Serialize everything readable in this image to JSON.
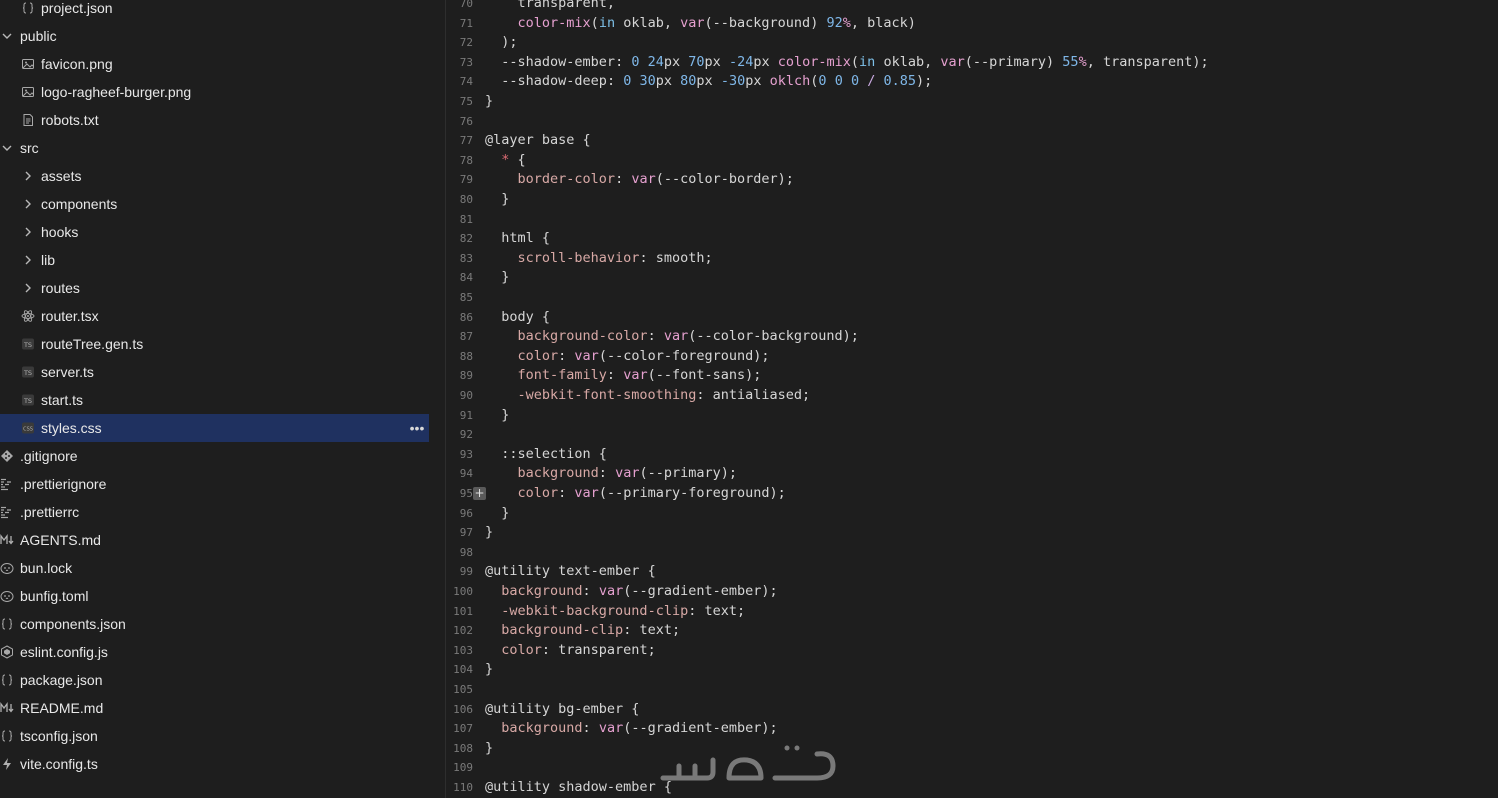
{
  "sidebar": {
    "items": [
      {
        "label": "project.json",
        "icon": "braces-icon",
        "depth": 1
      },
      {
        "label": "public",
        "icon": "chevron-down-icon",
        "depth": 0,
        "folder": true
      },
      {
        "label": "favicon.png",
        "icon": "image-icon",
        "depth": 1
      },
      {
        "label": "logo-ragheef-burger.png",
        "icon": "image-icon",
        "depth": 1
      },
      {
        "label": "robots.txt",
        "icon": "file-text-icon",
        "depth": 1
      },
      {
        "label": "src",
        "icon": "chevron-down-icon",
        "depth": 0,
        "folder": true
      },
      {
        "label": "assets",
        "icon": "chevron-right-icon",
        "depth": 1,
        "folder": true
      },
      {
        "label": "components",
        "icon": "chevron-right-icon",
        "depth": 1,
        "folder": true
      },
      {
        "label": "hooks",
        "icon": "chevron-right-icon",
        "depth": 1,
        "folder": true
      },
      {
        "label": "lib",
        "icon": "chevron-right-icon",
        "depth": 1,
        "folder": true
      },
      {
        "label": "routes",
        "icon": "chevron-right-icon",
        "depth": 1,
        "folder": true
      },
      {
        "label": "router.tsx",
        "icon": "react-icon",
        "depth": 1
      },
      {
        "label": "routeTree.gen.ts",
        "icon": "typescript-icon",
        "depth": 1
      },
      {
        "label": "server.ts",
        "icon": "typescript-icon",
        "depth": 1
      },
      {
        "label": "start.ts",
        "icon": "typescript-icon",
        "depth": 1
      },
      {
        "label": "styles.css",
        "icon": "css-icon",
        "depth": 1,
        "selected": true
      },
      {
        "label": ".gitignore",
        "icon": "git-icon",
        "depth": 0
      },
      {
        "label": ".prettierignore",
        "icon": "prettier-icon",
        "depth": 0
      },
      {
        "label": ".prettierrc",
        "icon": "prettier-icon",
        "depth": 0
      },
      {
        "label": "AGENTS.md",
        "icon": "markdown-icon",
        "depth": 0
      },
      {
        "label": "bun.lock",
        "icon": "bun-icon",
        "depth": 0
      },
      {
        "label": "bunfig.toml",
        "icon": "bun-icon",
        "depth": 0
      },
      {
        "label": "components.json",
        "icon": "braces-icon",
        "depth": 0
      },
      {
        "label": "eslint.config.js",
        "icon": "eslint-icon",
        "depth": 0
      },
      {
        "label": "package.json",
        "icon": "braces-icon",
        "depth": 0
      },
      {
        "label": "README.md",
        "icon": "markdown-icon",
        "depth": 0
      },
      {
        "label": "tsconfig.json",
        "icon": "braces-icon",
        "depth": 0
      },
      {
        "label": "vite.config.ts",
        "icon": "vite-icon",
        "depth": 0
      }
    ],
    "more_label": "•••"
  },
  "editor": {
    "fold_label": "+",
    "lines": [
      {
        "n": "70",
        "code": "    transparent,"
      },
      {
        "n": "71",
        "code": "    color-mix(in oklab, var(--background) 92%, black)"
      },
      {
        "n": "72",
        "code": "  );"
      },
      {
        "n": "73",
        "code": "  --shadow-ember: 0 24px 70px -24px color-mix(in oklab, var(--primary) 55%, transparent);"
      },
      {
        "n": "74",
        "code": "  --shadow-deep: 0 30px 80px -30px oklch(0 0 0 / 0.85);"
      },
      {
        "n": "75",
        "code": "}"
      },
      {
        "n": "76",
        "code": ""
      },
      {
        "n": "77",
        "code": "@layer base {"
      },
      {
        "n": "78",
        "code": "  * {"
      },
      {
        "n": "79",
        "code": "    border-color: var(--color-border);"
      },
      {
        "n": "80",
        "code": "  }"
      },
      {
        "n": "81",
        "code": ""
      },
      {
        "n": "82",
        "code": "  html {"
      },
      {
        "n": "83",
        "code": "    scroll-behavior: smooth;"
      },
      {
        "n": "84",
        "code": "  }"
      },
      {
        "n": "85",
        "code": ""
      },
      {
        "n": "86",
        "code": "  body {"
      },
      {
        "n": "87",
        "code": "    background-color: var(--color-background);"
      },
      {
        "n": "88",
        "code": "    color: var(--color-foreground);"
      },
      {
        "n": "89",
        "code": "    font-family: var(--font-sans);"
      },
      {
        "n": "90",
        "code": "    -webkit-font-smoothing: antialiased;"
      },
      {
        "n": "91",
        "code": "  }"
      },
      {
        "n": "92",
        "code": ""
      },
      {
        "n": "93",
        "code": "  ::selection {"
      },
      {
        "n": "94",
        "code": "    background: var(--primary);"
      },
      {
        "n": "95",
        "code": "    color: var(--primary-foreground);"
      },
      {
        "n": "96",
        "code": "  }"
      },
      {
        "n": "97",
        "code": "}"
      },
      {
        "n": "98",
        "code": ""
      },
      {
        "n": "99",
        "code": "@utility text-ember {"
      },
      {
        "n": "100",
        "code": "  background: var(--gradient-ember);"
      },
      {
        "n": "101",
        "code": "  -webkit-background-clip: text;"
      },
      {
        "n": "102",
        "code": "  background-clip: text;"
      },
      {
        "n": "103",
        "code": "  color: transparent;"
      },
      {
        "n": "104",
        "code": "}"
      },
      {
        "n": "105",
        "code": ""
      },
      {
        "n": "106",
        "code": "@utility bg-ember {"
      },
      {
        "n": "107",
        "code": "  background: var(--gradient-ember);"
      },
      {
        "n": "108",
        "code": "}"
      },
      {
        "n": "109",
        "code": ""
      },
      {
        "n": "110",
        "code": "@utility shadow-ember {"
      }
    ]
  },
  "colors": {
    "background": "#1e1e1e",
    "selection": "#1f3160",
    "property": "#d8a9a6",
    "function": "#e5a0cf",
    "number": "#7fb7e8"
  }
}
